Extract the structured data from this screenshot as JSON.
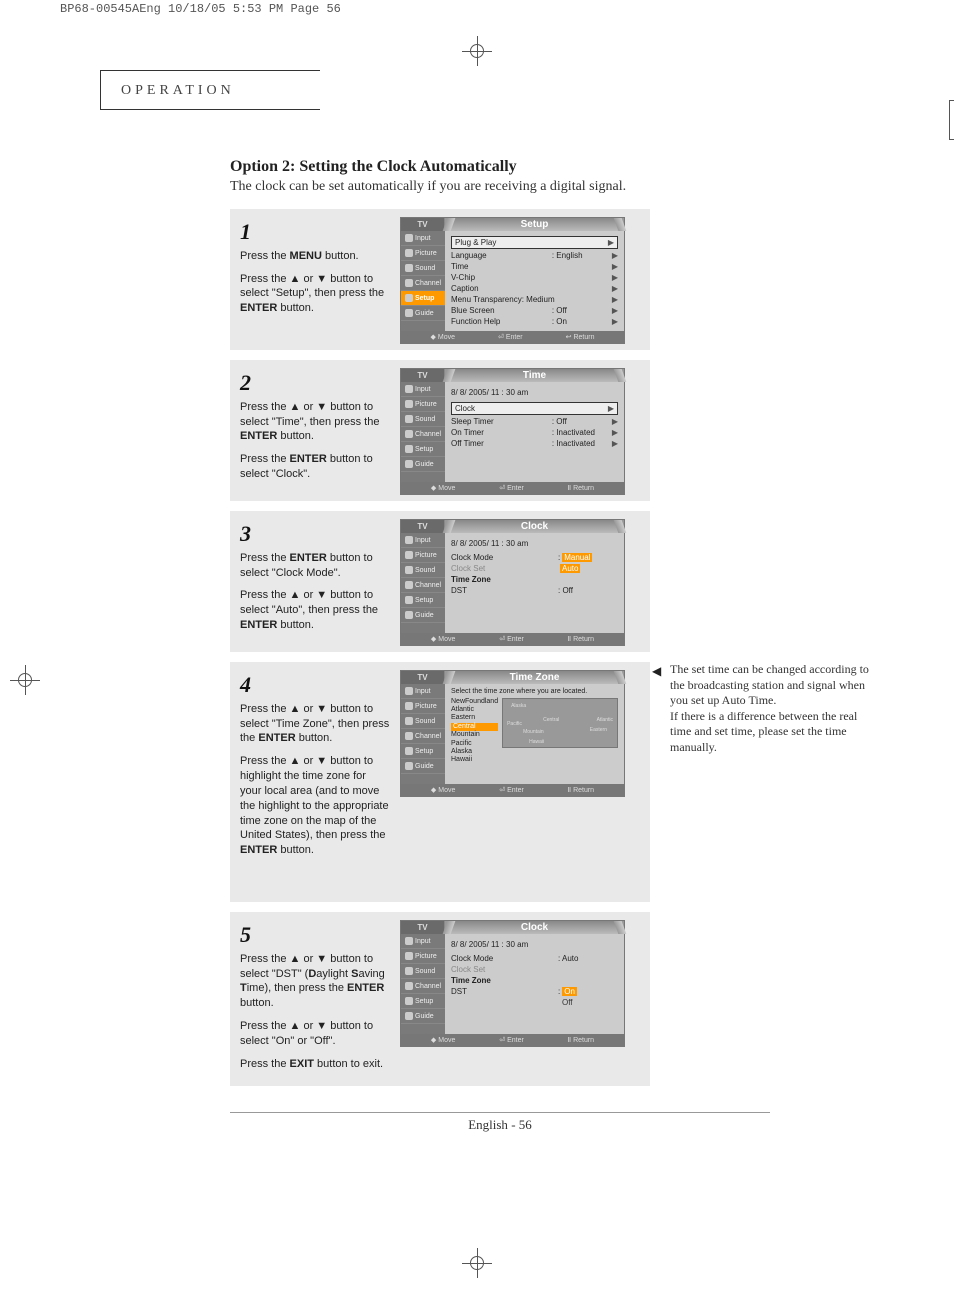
{
  "slug": "BP68-00545AEng  10/18/05  5:53 PM  Page 56",
  "section": "OPERATION",
  "title": "Option 2: Setting the Clock Automatically",
  "intro": "The clock can be set automatically if you are receiving a digital signal.",
  "sidebar": {
    "items": [
      "Input",
      "Picture",
      "Sound",
      "Channel",
      "Setup",
      "Guide"
    ]
  },
  "bottom": {
    "move": "Move",
    "enter": "Enter",
    "return": "Return"
  },
  "steps": {
    "s1": {
      "num": "1",
      "p1a": "Press the ",
      "p1b": "MENU",
      "p1c": " button.",
      "p2": "Press the  ▲ or ▼ button to select \"Setup\", then press the ",
      "p2b": "ENTER",
      "p2c": " button.",
      "screen": {
        "tv": "TV",
        "title": "Setup",
        "rows": [
          {
            "l": "Plug & Play",
            "v": "",
            "arr": "▶",
            "boxed": true
          },
          {
            "l": "Language",
            "v": ": English",
            "arr": "▶"
          },
          {
            "l": "Time",
            "v": "",
            "arr": "▶"
          },
          {
            "l": "V-Chip",
            "v": "",
            "arr": "▶"
          },
          {
            "l": "Caption",
            "v": "",
            "arr": "▶"
          },
          {
            "l": "Menu Transparency: Medium",
            "v": "",
            "arr": "▶"
          },
          {
            "l": "Blue Screen",
            "v": ": Off",
            "arr": "▶"
          },
          {
            "l": "Function Help",
            "v": ": On",
            "arr": "▶"
          }
        ]
      }
    },
    "s2": {
      "num": "2",
      "p1": "Press the  ▲ or ▼ button to select \"Time\", then press the ",
      "p1b": "ENTER",
      "p1c": " button.",
      "p2": "Press the ",
      "p2b": "ENTER",
      "p2c": " button to select \"Clock\".",
      "screen": {
        "tv": "TV",
        "title": "Time",
        "dt": "8/ 8/ 2005/ 11 : 30 am",
        "rows": [
          {
            "l": "Clock",
            "v": "",
            "arr": "▶",
            "boxed": true
          },
          {
            "l": "Sleep Timer",
            "v": ": Off",
            "arr": "▶"
          },
          {
            "l": "On Timer",
            "v": ": Inactivated",
            "arr": "▶"
          },
          {
            "l": "Off Timer",
            "v": ": Inactivated",
            "arr": "▶"
          }
        ]
      }
    },
    "s3": {
      "num": "3",
      "p1": "Press the ",
      "p1b": "ENTER",
      "p1c": " button to select \"Clock Mode\".",
      "p2": "Press the ▲ or ▼ button to select \"Auto\", then press the ",
      "p2b": "ENTER",
      "p2c": " button.",
      "screen": {
        "tv": "TV",
        "title": "Clock",
        "dt": "8/ 8/ 2005/ 11 : 30 am",
        "rows": [
          {
            "l": "Clock Mode",
            "v": ":",
            "dd1": "Manual",
            "dd2": "Auto"
          },
          {
            "l": "Clock Set",
            "v": "",
            "dim": true
          },
          {
            "l": "Time Zone",
            "v": ""
          },
          {
            "l": "DST",
            "v": ": Off"
          }
        ]
      }
    },
    "s4": {
      "num": "4",
      "p1": "Press the ▲ or ▼ button to select \"Time Zone\", then press the ",
      "p1b": "ENTER",
      "p1c": " button.",
      "p2": "Press the ▲ or ▼ button to highlight the time zone for your local area (and to move the highlight to the appropriate time zone on the map of the United States), then press the ",
      "p2b": "ENTER",
      "p2c": " button.",
      "screen": {
        "tv": "TV",
        "title": "Time Zone",
        "prompt": "Select the time zone where you are located.",
        "list": [
          "NewFoundland",
          "Atlantic",
          "Eastern",
          "Central",
          "Mountain",
          "Pacific",
          "Alaska",
          "Hawaii"
        ],
        "hl": "Central",
        "map_labels": [
          "Alaska",
          "Pacific",
          "Central",
          "Atlantic",
          "Mountain",
          "Hawaii",
          "Eastern"
        ]
      },
      "note": "The set time can be changed according to the  broadcasting station and signal when you set up Auto Time.\nIf there is a difference between the real time and set time, please set the time manually."
    },
    "s5": {
      "num": "5",
      "p1": "Press the ▲ or ▼ button to select \"DST\" (",
      "p1D": "D",
      "p1ay": "aylight ",
      "p1S": "S",
      "p1av": "aving ",
      "p1T": "T",
      "p1end": "ime), then press the ",
      "p1b": "ENTER",
      "p1c": " button.",
      "p2": "Press the ▲ or ▼ button to select \"On\" or \"Off\".",
      "p3": "Press the ",
      "p3b": "EXIT",
      "p3c": " button to exit.",
      "screen": {
        "tv": "TV",
        "title": "Clock",
        "dt": "8/ 8/ 2005/ 11 : 30 am",
        "rows": [
          {
            "l": "Clock Mode",
            "v": ": Auto"
          },
          {
            "l": "Clock Set",
            "v": "",
            "dim": true
          },
          {
            "l": "Time Zone",
            "v": ""
          },
          {
            "l": "DST",
            "v": ":",
            "dd1": "On",
            "dd2": "Off"
          }
        ]
      }
    }
  },
  "footer": {
    "lang": "English",
    "page": "56"
  }
}
